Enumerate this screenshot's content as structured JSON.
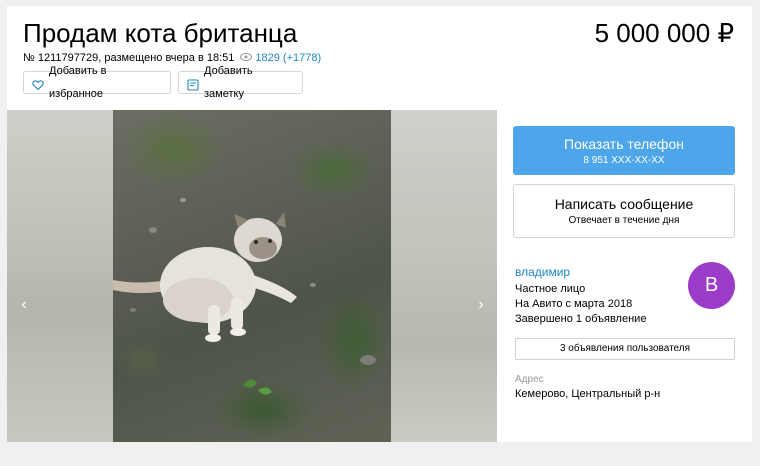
{
  "listing": {
    "title": "Продам кота британца",
    "price": "5 000 000 ₽",
    "meta_text": "№ 1211797729, размещено вчера в 18:51",
    "views": "1829 (+1778)"
  },
  "actions": {
    "favorite_label": "Добавить в избранное",
    "note_label": "Добавить заметку"
  },
  "gallery": {
    "prev_arrow": "‹",
    "next_arrow": "›"
  },
  "contact": {
    "phone_label": "Показать телефон",
    "phone_masked": "8 951 XXX-XX-XX",
    "message_label": "Написать сообщение",
    "message_sub": "Отвечает в течение дня"
  },
  "seller": {
    "name": "владимир",
    "type": "Частное лицо",
    "since": "На Авито с марта 2018",
    "completed": "Завершено 1 объявление",
    "avatar_letter": "В",
    "avatar_color": "#9b3bc9",
    "ads_button": "3 объявления пользователя"
  },
  "address": {
    "label": "Адрес",
    "value": "Кемерово, Центральный р-н"
  },
  "colors": {
    "accent_blue": "#4ea6ea",
    "link_blue": "#1e88c8"
  },
  "icons": {
    "favorite": "heart-icon",
    "note": "note-icon",
    "views": "eye-icon"
  }
}
